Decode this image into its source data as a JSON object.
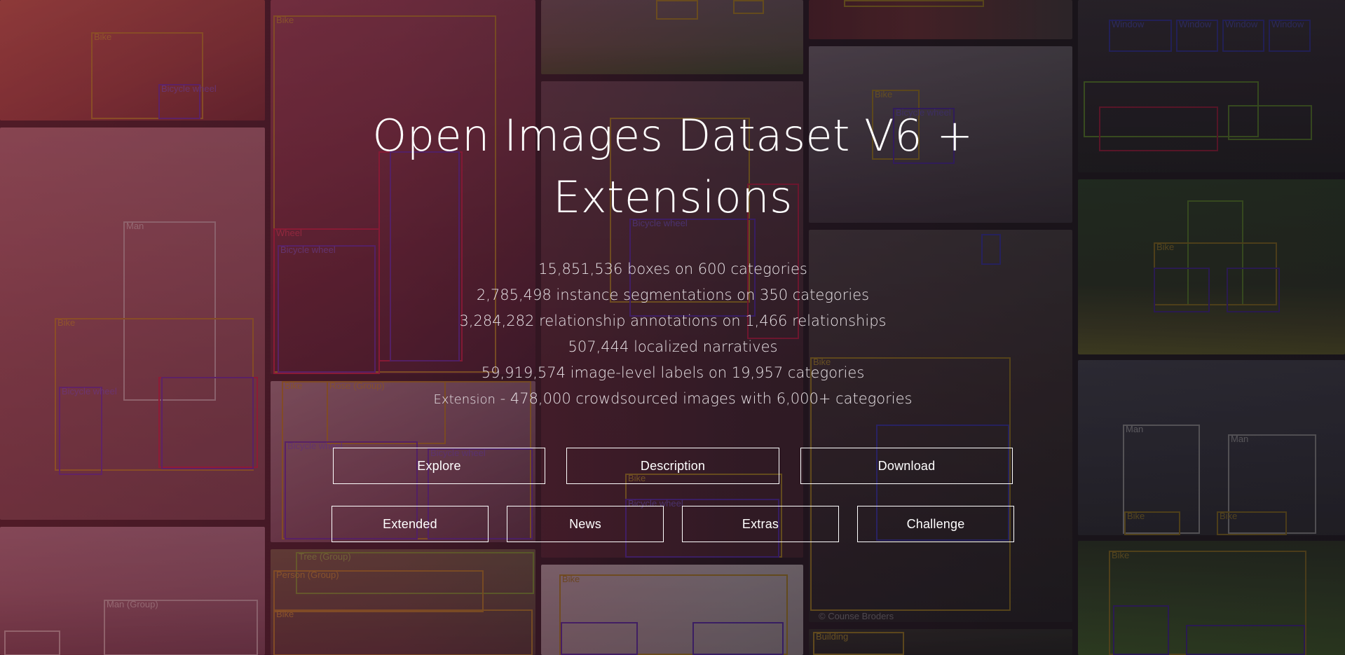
{
  "hero": {
    "title_line1": "Open Images Dataset V6 +",
    "title_line2": "Extensions",
    "stats": [
      "15,851,536 boxes on 600 categories",
      "2,785,498 instance segmentations on 350 categories",
      "3,284,282 relationship annotations on 1,466 relationships",
      "507,444 localized narratives",
      "59,919,574 image-level labels on 19,957 categories"
    ],
    "extension_prefix": "Extension",
    "extension_text": " - 478,000 crowdsourced images with 6,000+ categories"
  },
  "nav": {
    "row1": [
      "Explore",
      "Description",
      "Download"
    ],
    "row2": [
      "Extended",
      "News",
      "Extras",
      "Challenge"
    ]
  },
  "background": {
    "credit": "© Counse Broders",
    "box_labels": {
      "bike": "Bike",
      "man": "Man",
      "bicycle_wheel": "Bicycle wheel",
      "rose_group": "Rose (Group)",
      "tree_group": "Tree (Group)",
      "person_group": "Person (Group)",
      "man_group": "Man (Group)",
      "window": "Window",
      "wheel": "Wheel",
      "building": "Building"
    },
    "colors": {
      "bike": "#c8a020",
      "man": "#d8d8d8",
      "bicycle_wheel": "#5a30c8",
      "wheel": "#e0204a",
      "tree": "#80c030",
      "window": "#4040d8"
    }
  }
}
